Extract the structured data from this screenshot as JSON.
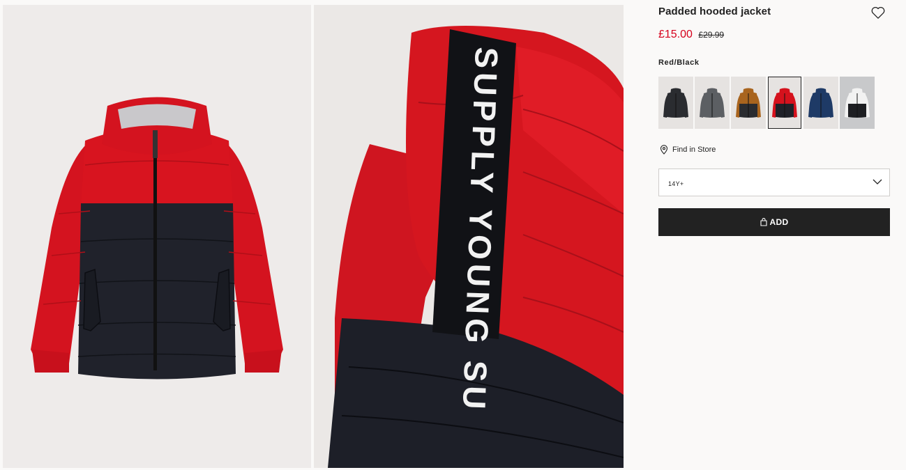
{
  "product": {
    "title": "Padded hooded jacket",
    "price_sale": "£15.00",
    "price_original": "£29.99",
    "selected_color": "Red/Black"
  },
  "swatches": [
    {
      "name": "black",
      "top": "#2a2c30",
      "bottom": "#2a2c30",
      "bg": "#e6e3e1"
    },
    {
      "name": "grey",
      "top": "#5c5f63",
      "bottom": "#5c5f63",
      "bg": "#e6e3e1"
    },
    {
      "name": "brown-black",
      "top": "#a8641e",
      "bottom": "#2a2c30",
      "bg": "#e6e3e1"
    },
    {
      "name": "red-black",
      "top": "#d5121d",
      "bottom": "#1f2128",
      "bg": "#e6e3e1"
    },
    {
      "name": "navy",
      "top": "#1e3a66",
      "bottom": "#1e3a66",
      "bg": "#e6e3e1"
    },
    {
      "name": "white-black",
      "top": "#f2f2f2",
      "bottom": "#1d1e22",
      "bg": "#c8c9cb"
    }
  ],
  "store": {
    "find_label": "Find in Store"
  },
  "size": {
    "selected": "14Y+"
  },
  "cart": {
    "add_label": "ADD"
  },
  "hood_tape_text": "SUPPLY YOUNG SU",
  "colors": {
    "sale_red": "#d6001c",
    "button_dark": "#222222",
    "jacket_red": "#d11722",
    "jacket_navy": "#1e2029"
  }
}
